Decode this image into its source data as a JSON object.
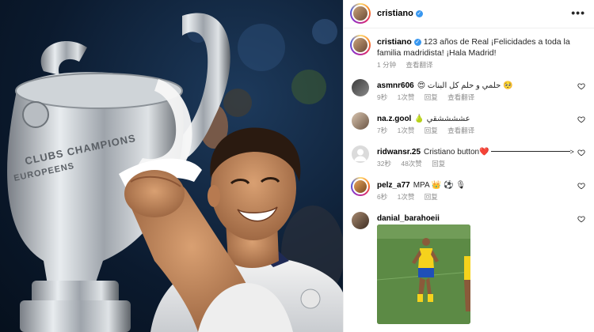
{
  "post": {
    "author": "cristiano",
    "caption": "123 años de Real ¡Felicidades a toda la familia madridista! ¡Hala Madrid!",
    "time": "1 分钟",
    "see_translation": "查看翻译"
  },
  "comments": [
    {
      "user": "asmnr606",
      "text": "😍 حلمي و حلم كل البنات 🥺",
      "time": "9秒",
      "likes": "1次赞",
      "reply": "回复",
      "translate": "查看翻译"
    },
    {
      "user": "na.z.gool",
      "text": "🍐 عششششقي",
      "time": "7秒",
      "likes": "1次赞",
      "reply": "回复",
      "translate": "查看翻译"
    },
    {
      "user": "ridwansr.25",
      "text": "Cristiano button❤️",
      "time": "32秒",
      "likes": "48次赞",
      "reply": "回复"
    },
    {
      "user": "pelz_a77",
      "text": "MPA 👑 ⚽ 🎙",
      "time": "6秒",
      "likes": "1次赞",
      "reply": "回复"
    },
    {
      "user": "danial_barahoeii",
      "text": ""
    }
  ],
  "colors": {
    "verified": "#3897f0",
    "meta_text": "#8e8e8e",
    "heart_like": "#ed4956"
  },
  "icons": {
    "more": "more-horizontal-icon",
    "heart": "heart-outline-icon",
    "verified": "verified-badge-icon"
  }
}
